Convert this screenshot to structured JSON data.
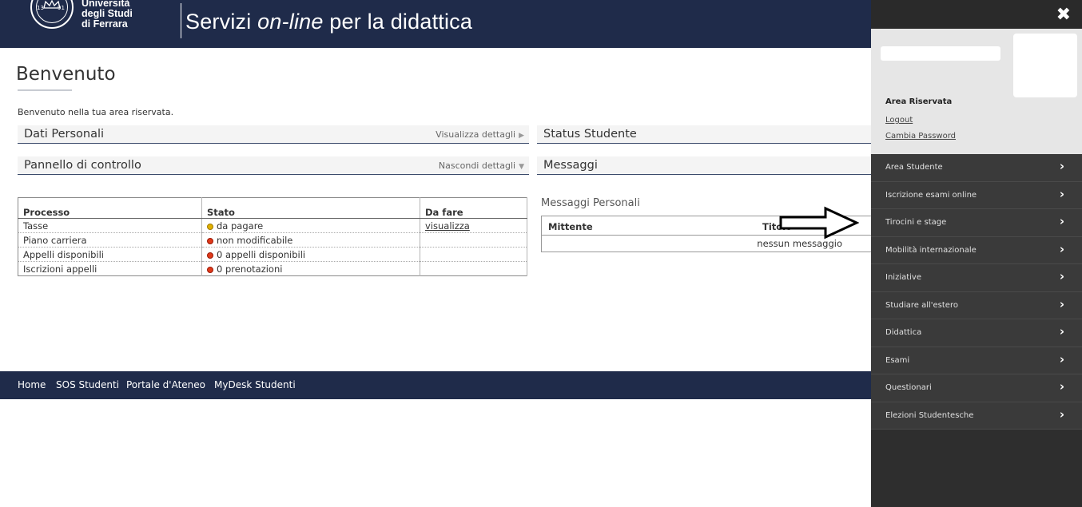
{
  "header": {
    "logo_lines": [
      "Università",
      "degli Studi",
      "di Ferrara"
    ],
    "title_prefix": "Servizi ",
    "title_em": "on-line",
    "title_suffix": " per la didattica"
  },
  "main": {
    "page_title": "Benvenuto",
    "welcome_text": "Benvenuto nella tua area riservata.",
    "sections": {
      "dati_personali": {
        "label": "Dati Personali",
        "action": "Visualizza dettagli",
        "action_icon": "▶"
      },
      "status_studente": {
        "label": "Status Studente"
      },
      "pannello": {
        "label": "Pannello di controllo",
        "action": "Nascondi dettagli",
        "action_icon": "▼"
      },
      "messaggi": {
        "label": "Messaggi"
      }
    },
    "process_table": {
      "headers": [
        "Processo",
        "Stato",
        "Da fare"
      ],
      "rows": [
        {
          "processo": "Tasse",
          "status_color": "yellow",
          "stato": "da pagare",
          "da_fare": "visualizza"
        },
        {
          "processo": "Piano carriera",
          "status_color": "red",
          "stato": "non modificabile",
          "da_fare": ""
        },
        {
          "processo": "Appelli disponibili",
          "status_color": "red",
          "stato": "0 appelli disponibili",
          "da_fare": ""
        },
        {
          "processo": "Iscrizioni appelli",
          "status_color": "red",
          "stato": "0 prenotazioni",
          "da_fare": ""
        }
      ]
    },
    "messages": {
      "title": "Messaggi Personali",
      "headers": [
        "Mittente",
        "Titolo"
      ],
      "empty_text": "nessun messaggio"
    }
  },
  "footer": {
    "links": [
      "Home",
      "SOS Studenti",
      "Portale d'Ateneo",
      "MyDesk Studenti"
    ]
  },
  "side_panel": {
    "close_icon": "✖",
    "area_title": "Area Riservata",
    "logout": "Logout",
    "change_password": "Cambia Password",
    "menu_items": [
      "Area Studente",
      "Iscrizione esami online",
      "Tirocini e stage",
      "Mobilità internazionale",
      "Iniziative",
      "Studiare all'estero",
      "Didattica",
      "Esami",
      "Questionari",
      "Elezioni Studentesche"
    ],
    "chevron": "›"
  },
  "colors": {
    "header_bg": "#1f2b4a",
    "side_bg": "#2e2e2e",
    "status_yellow": "#e0b000",
    "status_red": "#e03a1a"
  }
}
